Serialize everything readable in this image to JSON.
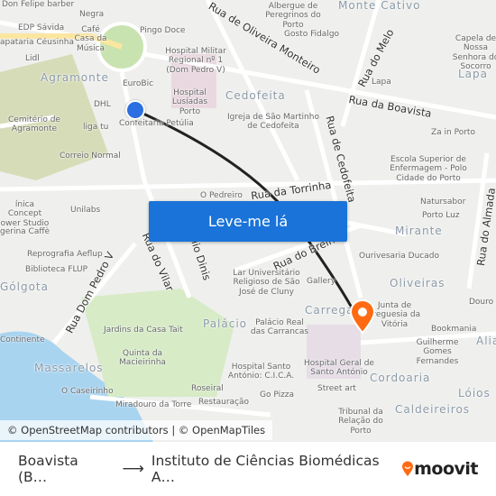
{
  "map": {
    "labels": [
      "Don Felipe barber",
      "Negra",
      "EDP Sávida",
      "Café Casa da Música",
      "apataria Céusinha",
      "Pingo Doce",
      "Lidl",
      "Hospital Militar Regional nº 1 (Dom Pedro V)",
      "EuroBic",
      "Hospital Lusíadas Porto",
      "DHL",
      "Confeitaria Petúlia",
      "Cemitério de Agramonte",
      "liga tu",
      "Correio Normal",
      "O Pedreiro",
      "Unilabs",
      "ínica Concept ower Studio",
      "gerina Caffè",
      "Reprografia Aeflup",
      "Biblioteca FLUP",
      "Albergue de Peregrinos do Porto",
      "Gosto Fidalgo",
      "Capela de Nossa Senhora do Socorro",
      "Lapa",
      "Igreja de São Martinho de Cedofeita",
      "Za in Porto",
      "Escola Superior de Enfermagem - Polo Cidade do Porto",
      "Natursabor",
      "Porto Luz",
      "Ourivesaria Ducado",
      "Lar Universitário Religioso de São José de Cluny",
      "Gallery",
      "Junta de Freguesia da Vitória",
      "Palácio Real das Carrancas",
      "Bookmania",
      "Guilherme Gomes Fernandes",
      "Jardins da Casa Tait",
      "Quinta da Macieirinha",
      "Hospital Santo António: C.I.C.A.",
      "Hospital Geral de Santo António",
      "Roseiral",
      "Restauração",
      "Miradouro da Torre",
      "Go Pizza",
      "Street art",
      "Tribunal da Relação do Porto",
      "O Caseirinho",
      "Continente",
      "Douro"
    ],
    "areas": [
      "Agramonte",
      "Cedofeita",
      "Monte Cativo",
      "Lapa",
      "Mirante",
      "Oliveiras",
      "Gólgota",
      "Palácio",
      "Carregal",
      "Cordoaria",
      "Massarelos",
      "Lóios",
      "Caldeireiros",
      "Alia"
    ],
    "streets": [
      "Rua de Oliveira Monteiro",
      "Rua do Melo",
      "Rua da Boavista",
      "Rua de Cedofeita",
      "Rua da Torrinha",
      "Rua do Breiner",
      "Rua do Almada",
      "Rua Dom Pedro V",
      "Rua do Vilar",
      "Rua Júlio Dinis"
    ],
    "route_color": "#222222",
    "origin_color": "#2b6fe0",
    "destination_color": "#ff6a13",
    "origin_icon": "origin-dot-icon",
    "destination_icon": "destination-pin-icon"
  },
  "cta": {
    "label": "Leve-me lá"
  },
  "attribution": "© OpenStreetMap contributors | © OpenMapTiles",
  "footer": {
    "origin": "Boavista (B…",
    "destination": "Instituto de Ciências Biomédicas A…",
    "brand": "moovit",
    "arrow_icon": "arrow-right-icon"
  }
}
